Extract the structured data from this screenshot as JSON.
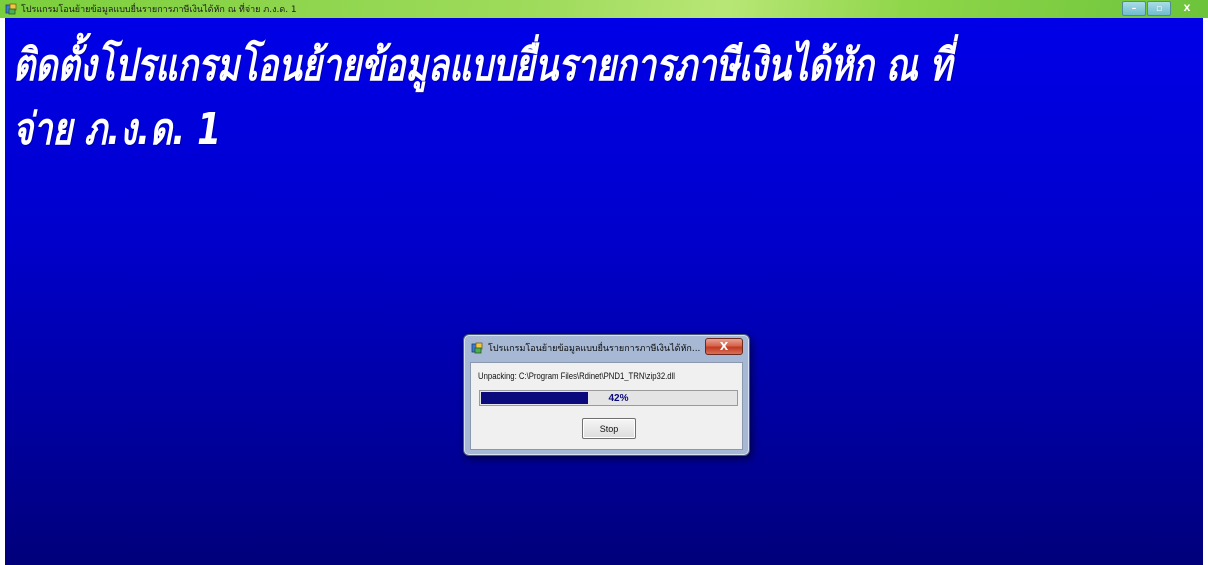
{
  "window": {
    "title": "โปรแกรมโอนย้ายข้อมูลแบบยื่นรายการภาษีเงินได้หัก ณ ที่จ่าย ภ.ง.ด. 1",
    "icon": "installer-icon",
    "buttons": {
      "minimize": "–",
      "maximize": "▫",
      "close": "X"
    }
  },
  "main": {
    "heading_line1": "ติดตั้งโปรแกรมโอนย้ายข้อมูลแบบยื่นรายการภาษีเงินได้หัก ณ ที่",
    "heading_line2": "จ่าย ภ.ง.ด. 1"
  },
  "dialog": {
    "title": "โปรแกรมโอนย้ายข้อมูลแบบยื่นรายการภาษีเงินได้หัก...",
    "close_label": "X",
    "status_text": "Unpacking: C:\\Program Files\\Rdinet\\PND1_TRN\\zip32.dll",
    "progress": 0.42,
    "progress_label": "42%",
    "stop_label": "Stop"
  },
  "colors": {
    "background_top": "#0000e8",
    "background_bottom": "#00007a",
    "titlebar": "#8fd64a",
    "progress_fill": "#0a0a7c"
  }
}
